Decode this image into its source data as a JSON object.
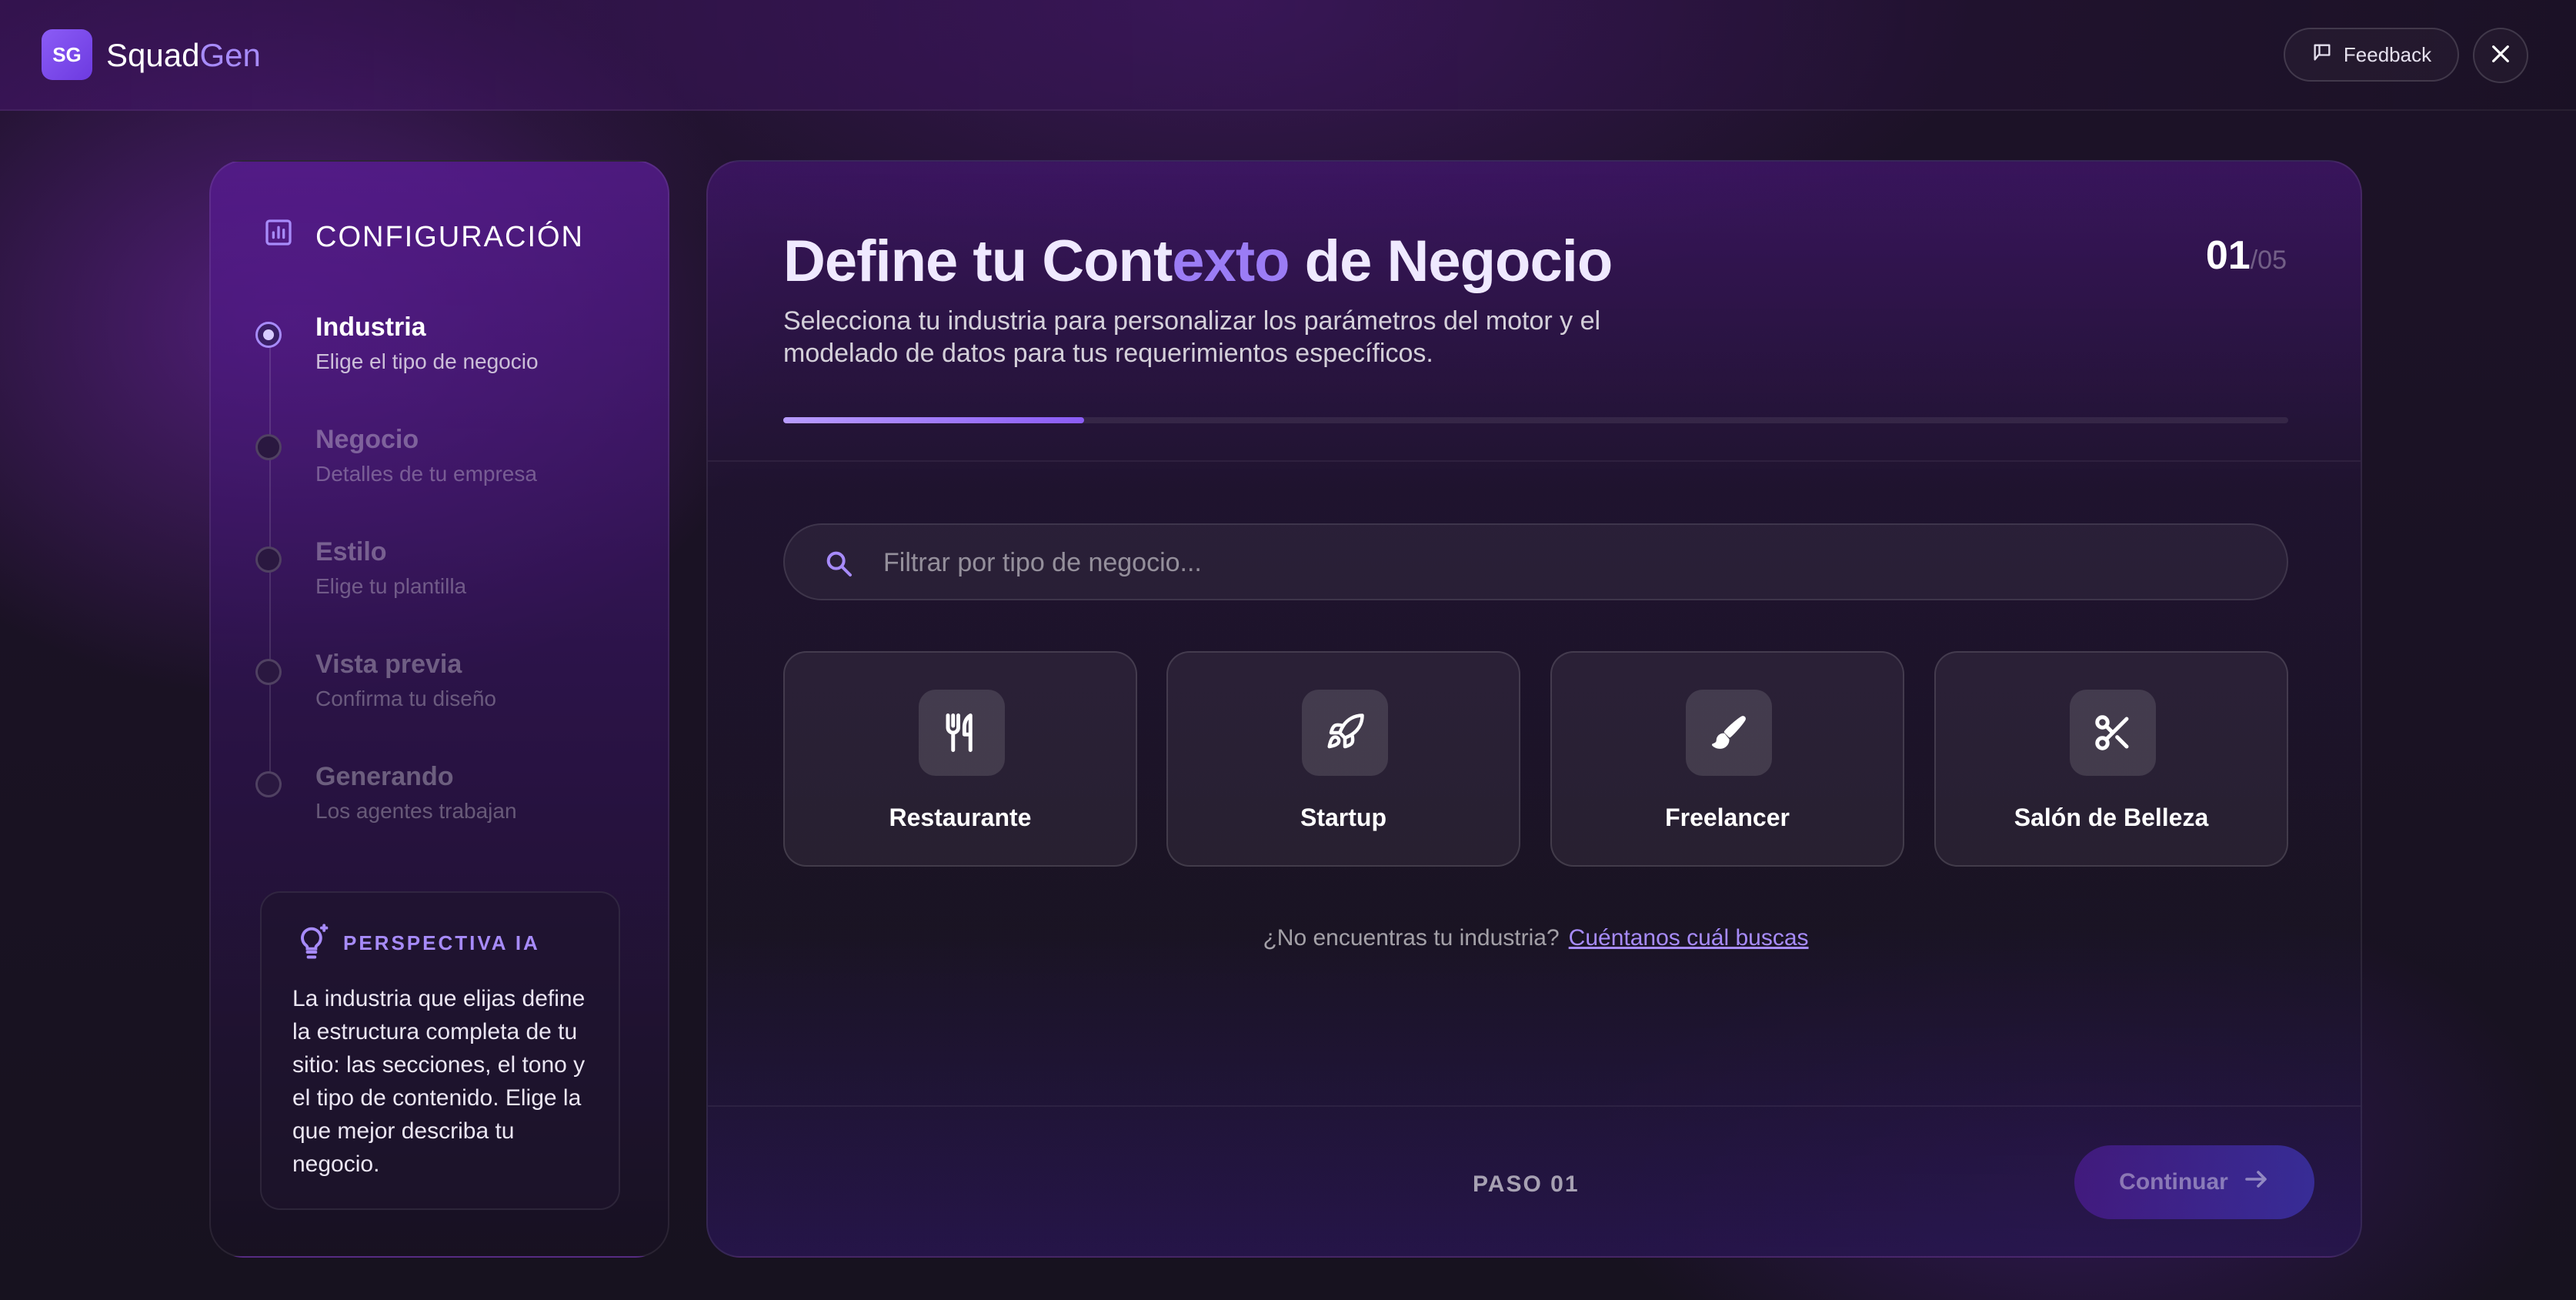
{
  "header": {
    "logo_initials": "SG",
    "brand_part1": "Squad",
    "brand_part2": "Gen",
    "feedback_label": "Feedback"
  },
  "sidebar": {
    "title": "CONFIGURACIÓN",
    "steps": [
      {
        "label": "Industria",
        "subtitle": "Elige el tipo de negocio",
        "active": true
      },
      {
        "label": "Negocio",
        "subtitle": "Detalles de tu empresa",
        "active": false
      },
      {
        "label": "Estilo",
        "subtitle": "Elige tu plantilla",
        "active": false
      },
      {
        "label": "Vista previa",
        "subtitle": "Confirma tu diseño",
        "active": false
      },
      {
        "label": "Generando",
        "subtitle": "Los agentes trabajan",
        "active": false
      }
    ],
    "insight": {
      "title": "PERSPECTIVA IA",
      "text": "La industria que elijas define la estructura completa de tu sitio: las secciones, el tono y el tipo de contenido. Elige la que mejor describa tu negocio."
    }
  },
  "main": {
    "heading_part1": "Define tu Cont",
    "heading_part2": "exto",
    "heading_part3": " de Negocio",
    "subtitle": "Selecciona tu industria para personalizar los parámetros del motor y el modelado de datos para tus requerimientos específicos.",
    "step_current": "01",
    "step_total": "/05",
    "progress_fraction": 0.2,
    "search_placeholder": "Filtrar por tipo de negocio...",
    "cards": [
      {
        "label": "Restaurante",
        "icon": "utensils-icon"
      },
      {
        "label": "Startup",
        "icon": "rocket-icon"
      },
      {
        "label": "Freelancer",
        "icon": "brush-icon"
      },
      {
        "label": "Salón de Belleza",
        "icon": "scissors-icon"
      }
    ],
    "hint_text": "¿No encuentras tu industria?",
    "hint_link": "Cuéntanos cuál buscas",
    "footer_step": "PASO 01",
    "continue_label": "Continuar"
  },
  "colors": {
    "accent": "#a78bfa",
    "accent_strong": "#8b5cf6",
    "background": "#15121c"
  }
}
